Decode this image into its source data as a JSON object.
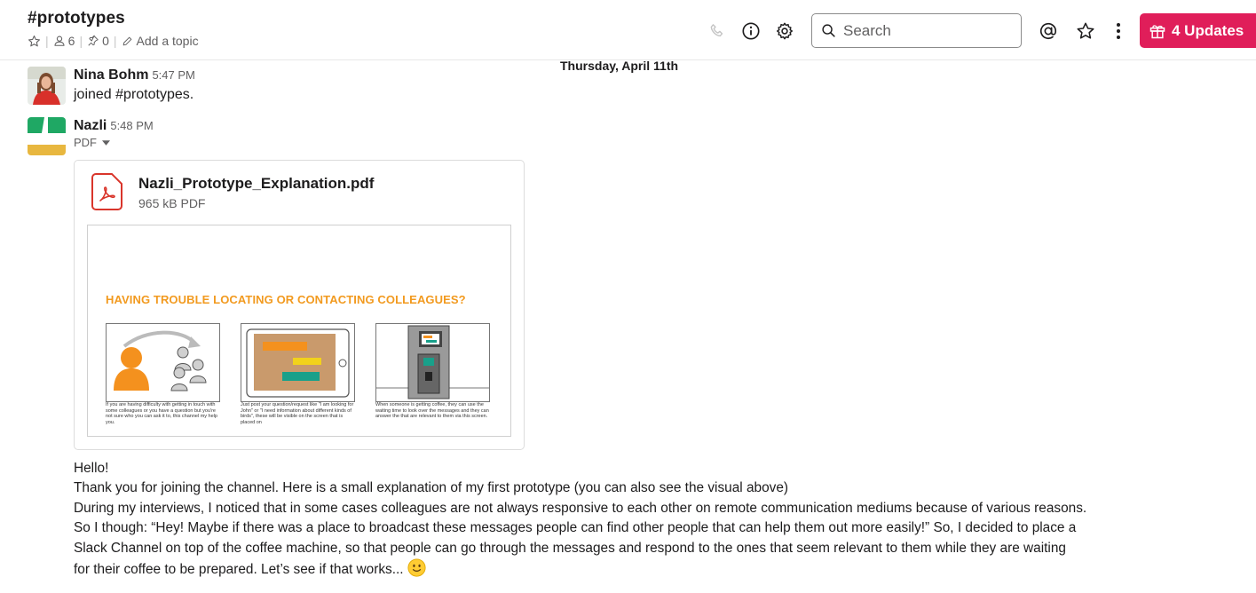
{
  "header": {
    "channel_name": "#prototypes",
    "members_count": "6",
    "pins_count": "0",
    "add_topic_label": "Add a topic",
    "search_placeholder": "Search",
    "updates_label": "4 Updates"
  },
  "date_divider": "Thursday, April 11th",
  "messages": [
    {
      "sender": "Nina Bohm",
      "time": "5:47 PM",
      "text": "joined #prototypes."
    },
    {
      "sender": "Nazli",
      "time": "5:48 PM",
      "file_type_label": "PDF"
    }
  ],
  "attachment": {
    "file_name": "Nazli_Prototype_Explanation.pdf",
    "file_info": "965 kB PDF",
    "preview_title": "HAVING TROUBLE LOCATING OR CONTACTING COLLEAGUES?",
    "captions": [
      "If you are having difficulty with getting in touch with some colleagues or you have a question but you're not sure who you can ask it to, this channel my help you.",
      "Just post your question/request like \"I am looking for John\" or \"I need information about different kinds of birds\", these will be visible on the screen that is placed on",
      "When someone is getting coffee, they can use the waiting time to look over the messages and they can answer the that are relevant to them via this screen."
    ]
  },
  "body": {
    "line1": "Hello!",
    "line2": "Thank you for joining the channel. Here is a small explanation of my first prototype (you can also see the visual above)",
    "line3": "During my interviews, I noticed that in some cases colleagues are not always responsive to each other on remote communication mediums because of various reasons.",
    "line4": "So I though: “Hey! Maybe if there was a place to broadcast these messages people can find other people that can help them out more easily!” So, I decided to place a",
    "line5": "Slack Channel on top of the coffee machine, so that people can go through the messages and respond to the ones that seem relevant to them while they are waiting",
    "line6": "for their coffee to be prepared. Let’s see if that works..."
  },
  "colors": {
    "updates_bg": "#e01e5a",
    "pdf_icon": "#d9352b",
    "preview_title": "#f29a1f"
  }
}
